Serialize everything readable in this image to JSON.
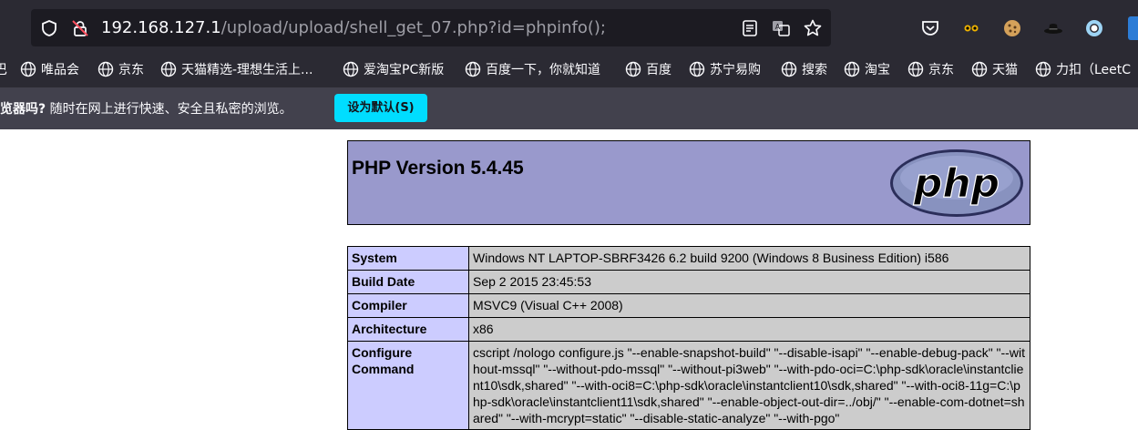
{
  "browser": {
    "url_host": "192.168.127.1",
    "url_path": "/upload/upload/shell_get_07.php?id=phpinfo();",
    "icons": [
      "shield-icon",
      "insecure-lock-icon",
      "reader-view-icon",
      "translate-icon",
      "bookmark-star-icon",
      "pocket-icon",
      "extension-mask-icon",
      "cookie-icon",
      "hat-icon",
      "circle-icon"
    ],
    "bookmarks": [
      {
        "label": "唯品会"
      },
      {
        "label": "京东"
      },
      {
        "label": "天猫精选-理想生活上..."
      },
      {
        "label": "爱淘宝PC新版"
      },
      {
        "label": "百度一下，你就知道"
      },
      {
        "label": "百度"
      },
      {
        "label": "苏宁易购"
      },
      {
        "label": "搜索"
      },
      {
        "label": "淘宝"
      },
      {
        "label": "京东"
      },
      {
        "label": "天猫"
      },
      {
        "label": "力扣（LeetC"
      }
    ],
    "bookmark_fragment": "巴",
    "notice": {
      "bold": "览器吗?",
      "text": " 随时在网上进行快速、安全且私密的浏览。",
      "button": "设为默认(S)"
    }
  },
  "phpinfo": {
    "version_title": "PHP Version 5.4.45",
    "logo_text": "php",
    "rows": [
      {
        "key": "System",
        "value": "Windows NT LAPTOP-SBRF3426 6.2 build 9200 (Windows 8 Business Edition) i586"
      },
      {
        "key": "Build Date",
        "value": "Sep 2 2015 23:45:53"
      },
      {
        "key": "Compiler",
        "value": "MSVC9 (Visual C++ 2008)"
      },
      {
        "key": "Architecture",
        "value": "x86"
      },
      {
        "key": "Configure Command",
        "value": "cscript /nologo configure.js \"--enable-snapshot-build\" \"--disable-isapi\" \"--enable-debug-pack\" \"--without-mssql\" \"--without-pdo-mssql\" \"--without-pi3web\" \"--with-pdo-oci=C:\\php-sdk\\oracle\\instantclient10\\sdk,shared\" \"--with-oci8=C:\\php-sdk\\oracle\\instantclient10\\sdk,shared\" \"--with-oci8-11g=C:\\php-sdk\\oracle\\instantclient11\\sdk,shared\" \"--enable-object-out-dir=../obj/\" \"--enable-com-dotnet=shared\" \"--with-mcrypt=static\" \"--disable-static-analyze\" \"--with-pgo\""
      }
    ]
  },
  "colors": {
    "chrome_bg": "#2b2a33",
    "urlbar_bg": "#1c1b22",
    "notice_bg": "#42414d",
    "notice_button": "#00ddff",
    "php_header": "#9999cc",
    "php_key_cell": "#ccccff",
    "php_value_cell": "#cccccc"
  }
}
